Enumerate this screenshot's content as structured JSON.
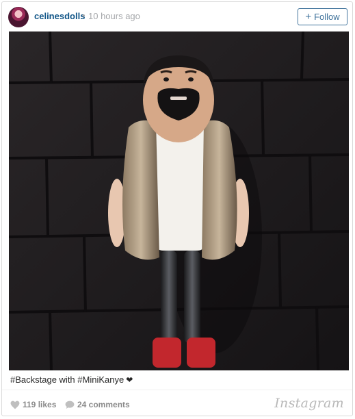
{
  "post": {
    "username": "celinesdolls",
    "separator": "•",
    "time_ago": "10 hours ago",
    "follow_label": "Follow",
    "follow_icon": "plus-icon",
    "caption": "#Backstage with #MiniKanye",
    "caption_icon": "heart-icon",
    "likes": "119 likes",
    "comments": "24 comments",
    "brand": "Instagram",
    "colors": {
      "username": "#125688",
      "follow_border": "#3f729b",
      "meta_gray": "#a5a7aa"
    }
  }
}
